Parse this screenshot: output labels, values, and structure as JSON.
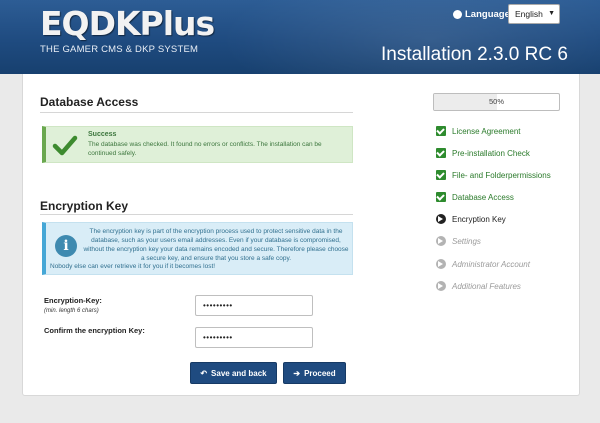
{
  "header": {
    "logo_text": "EQDKPlus",
    "logo_subtitle": "THE GAMER CMS & DKP SYSTEM",
    "language_label": "Language:",
    "language_value": "English",
    "version_title": "Installation 2.3.0 RC 6"
  },
  "database_access": {
    "title": "Database Access",
    "success_title": "Success",
    "success_text": "The database was checked. It found no errors or conflicts. The installation can be continued safely."
  },
  "encryption": {
    "title": "Encryption Key",
    "info_text": "The encryption key is part of the encryption process used to protect sensitive data in the database, such as your users email addresses. Even if your database is compromised, without the encryption key your data remains encoded and secure. Therefore please choose a secure key, and ensure that you store a safe copy.",
    "info_text_last": "Nobody else can ever retrieve it for you if it becomes lost!",
    "key_label": "Encryption-Key:",
    "key_hint": "(min. length 6 chars)",
    "key_value": "•••••••••",
    "confirm_label": "Confirm the encryption Key:",
    "confirm_value": "•••••••••"
  },
  "buttons": {
    "save_back": "Save and back",
    "proceed": "Proceed"
  },
  "progress": {
    "label": "50%",
    "value": 50
  },
  "steps": [
    {
      "label": "License Agreement",
      "state": "done"
    },
    {
      "label": "Pre-installation Check",
      "state": "done"
    },
    {
      "label": "File- and Folderpermissions",
      "state": "done"
    },
    {
      "label": "Database Access",
      "state": "done"
    },
    {
      "label": "Encryption Key",
      "state": "current"
    },
    {
      "label": "Settings",
      "state": "pending"
    },
    {
      "label": "Administrator Account",
      "state": "pending"
    },
    {
      "label": "Additional Features",
      "state": "pending"
    }
  ],
  "colors": {
    "header_blue": "#1f4b80",
    "success_green": "#3c763d",
    "info_blue": "#31708f",
    "step_done": "#2e8b2e"
  }
}
